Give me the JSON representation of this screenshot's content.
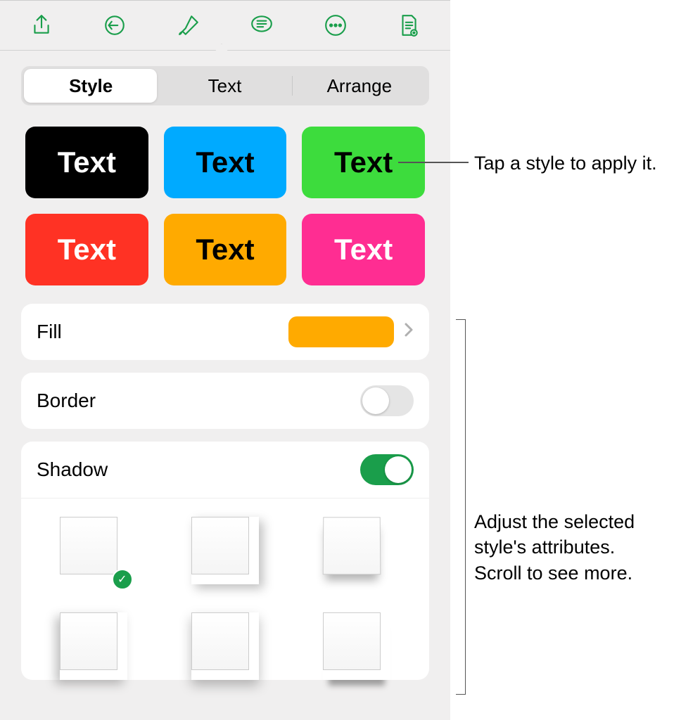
{
  "toolbar": {
    "icons": [
      "share",
      "undo",
      "format",
      "insert",
      "more",
      "document"
    ]
  },
  "popover": {
    "segments": {
      "style": "Style",
      "text": "Text",
      "arrange": "Arrange",
      "active": "style"
    },
    "swatch_label": "Text",
    "swatches": [
      {
        "color": "black"
      },
      {
        "color": "blue"
      },
      {
        "color": "green"
      },
      {
        "color": "red"
      },
      {
        "color": "orange"
      },
      {
        "color": "pink"
      }
    ],
    "fill": {
      "label": "Fill",
      "color": "#ffaa00"
    },
    "border": {
      "label": "Border",
      "enabled": false
    },
    "shadow": {
      "label": "Shadow",
      "enabled": true,
      "selected_index": 0,
      "options_count": 6
    }
  },
  "callouts": {
    "c1": "Tap a style to apply it.",
    "c2_line1": "Adjust the selected",
    "c2_line2": "style's attributes.",
    "c2_line3": "Scroll to see more."
  }
}
